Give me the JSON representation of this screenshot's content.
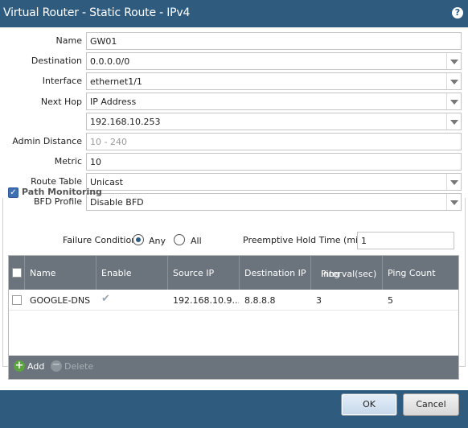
{
  "dialog": {
    "title": "Virtual Router - Static Route - IPv4",
    "help_icon": "?"
  },
  "form": {
    "name_label": "Name",
    "name_value": "GW01",
    "destination_label": "Destination",
    "destination_value": "0.0.0.0/0",
    "interface_label": "Interface",
    "interface_value": "ethernet1/1",
    "next_hop_label": "Next Hop",
    "next_hop_type": "IP Address",
    "next_hop_value": "192.168.10.253",
    "admin_distance_label": "Admin Distance",
    "admin_distance_placeholder": "10 - 240",
    "metric_label": "Metric",
    "metric_value": "10",
    "route_table_label": "Route Table",
    "route_table_value": "Unicast",
    "bfd_profile_label": "BFD Profile",
    "bfd_profile_value": "Disable BFD"
  },
  "path_monitoring": {
    "title": "Path Monitoring",
    "enabled": true,
    "failure_condition_label": "Failure Condition",
    "option_any": "Any",
    "option_all": "All",
    "selected": "Any",
    "preemptive_hold_label": "Preemptive Hold Time (min)",
    "preemptive_hold_value": "1",
    "table": {
      "columns": [
        "Name",
        "Enable",
        "Source IP",
        "Destination IP",
        "Ping Interval(sec)",
        "Ping Count"
      ],
      "col_ping_interval_line1": "Ping",
      "col_ping_interval_line2": "Interval(sec)",
      "rows": [
        {
          "name": "GOOGLE-DNS",
          "enable": true,
          "source_ip": "192.168.10.9...",
          "destination_ip": "8.8.8.8",
          "ping_interval": "3",
          "ping_count": "5"
        }
      ],
      "add_label": "Add",
      "delete_label": "Delete"
    }
  },
  "buttons": {
    "ok": "OK",
    "cancel": "Cancel"
  },
  "colors": {
    "title_bar": "#2f5b7e",
    "grid_header": "#6b737c",
    "checkbox_blue": "#3c6fb4",
    "add_green": "#5aa33e"
  }
}
